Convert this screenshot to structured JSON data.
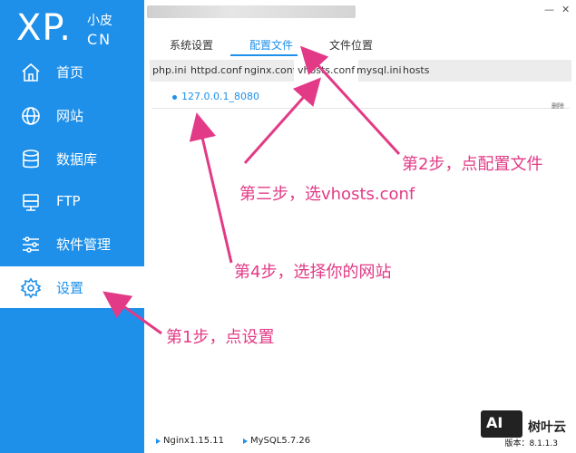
{
  "logo": {
    "xp": "XP.",
    "top": "小皮",
    "bottom": "CN"
  },
  "sidebar": {
    "items": [
      {
        "label": "首页",
        "icon": "home-icon"
      },
      {
        "label": "网站",
        "icon": "globe-icon"
      },
      {
        "label": "数据库",
        "icon": "database-icon"
      },
      {
        "label": "FTP",
        "icon": "ftp-icon"
      },
      {
        "label": "软件管理",
        "icon": "sliders-icon"
      },
      {
        "label": "设置",
        "icon": "gear-icon",
        "active": true
      }
    ]
  },
  "tabs": [
    "系统设置",
    "配置文件",
    "文件位置"
  ],
  "subtabs": [
    "php.ini",
    "httpd.conf",
    "nginx.conf",
    "vhosts.conf",
    "mysql.ini",
    "hosts"
  ],
  "sites": [
    "127.0.0.1_8080"
  ],
  "small_action": "删除",
  "status": {
    "nginx": "Nginx1.15.11",
    "mysql": "MySQL5.7.26",
    "version": "版本：8.1.1.3"
  },
  "annotations": {
    "step1": "第1步，点设置",
    "step2": "第2步，点配置文件",
    "step3": "第三步，选vhosts.conf",
    "step4": "第4步，选择你的网站"
  },
  "watermark": {
    "box": "AI",
    "text": "树叶云"
  },
  "colors": {
    "accent": "#1e90ea",
    "annotation": "#e23a86"
  }
}
